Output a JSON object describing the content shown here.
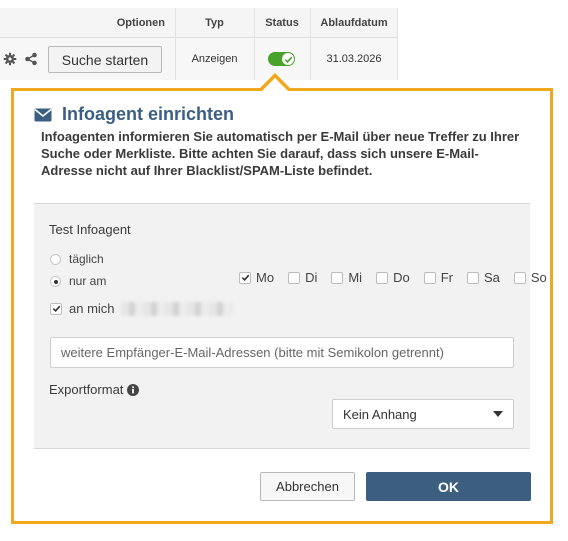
{
  "table": {
    "headers": [
      "Optionen",
      "Typ",
      "Status",
      "Ablaufdatum"
    ],
    "row": {
      "search_button": "Suche starten",
      "typ": "Anzeigen",
      "status_on": true,
      "ablaufdatum": "31.03.2026"
    }
  },
  "popup": {
    "title": "Infoagent einrichten",
    "description": "Infoagenten informieren Sie automatisch per E-Mail über neue Treffer zu Ihrer Suche oder Merkliste. Bitte achten Sie darauf, dass sich unsere E-Mail-Adresse nicht auf Ihrer Blacklist/SPAM-Liste befindet.",
    "agent_name": "Test Infoagent",
    "frequency": {
      "options": [
        {
          "label": "täglich",
          "checked": false
        },
        {
          "label": "nur am",
          "checked": true
        }
      ]
    },
    "days": [
      {
        "label": "Mo",
        "checked": true
      },
      {
        "label": "Di",
        "checked": false
      },
      {
        "label": "Mi",
        "checked": false
      },
      {
        "label": "Do",
        "checked": false
      },
      {
        "label": "Fr",
        "checked": false
      },
      {
        "label": "Sa",
        "checked": false
      },
      {
        "label": "So",
        "checked": false
      }
    ],
    "send_to_me": {
      "label": "an mich",
      "checked": true
    },
    "extra_recipients_placeholder": "weitere Empfänger-E-Mail-Adressen (bitte mit Semikolon getrennt)",
    "export_label": "Exportformat",
    "export_value": "Kein Anhang",
    "cancel_label": "Abbrechen",
    "ok_label": "OK"
  },
  "colors": {
    "popup_border": "#f0a81e",
    "title": "#3a5f80",
    "ok_button": "#3c5f80",
    "toggle_on": "#49a32b"
  },
  "icons": {
    "options": [
      "gear-icon",
      "share-icon"
    ],
    "title": "envelope-icon",
    "status": "check-icon",
    "export_info": "info-icon",
    "select": "caret-down-icon"
  }
}
